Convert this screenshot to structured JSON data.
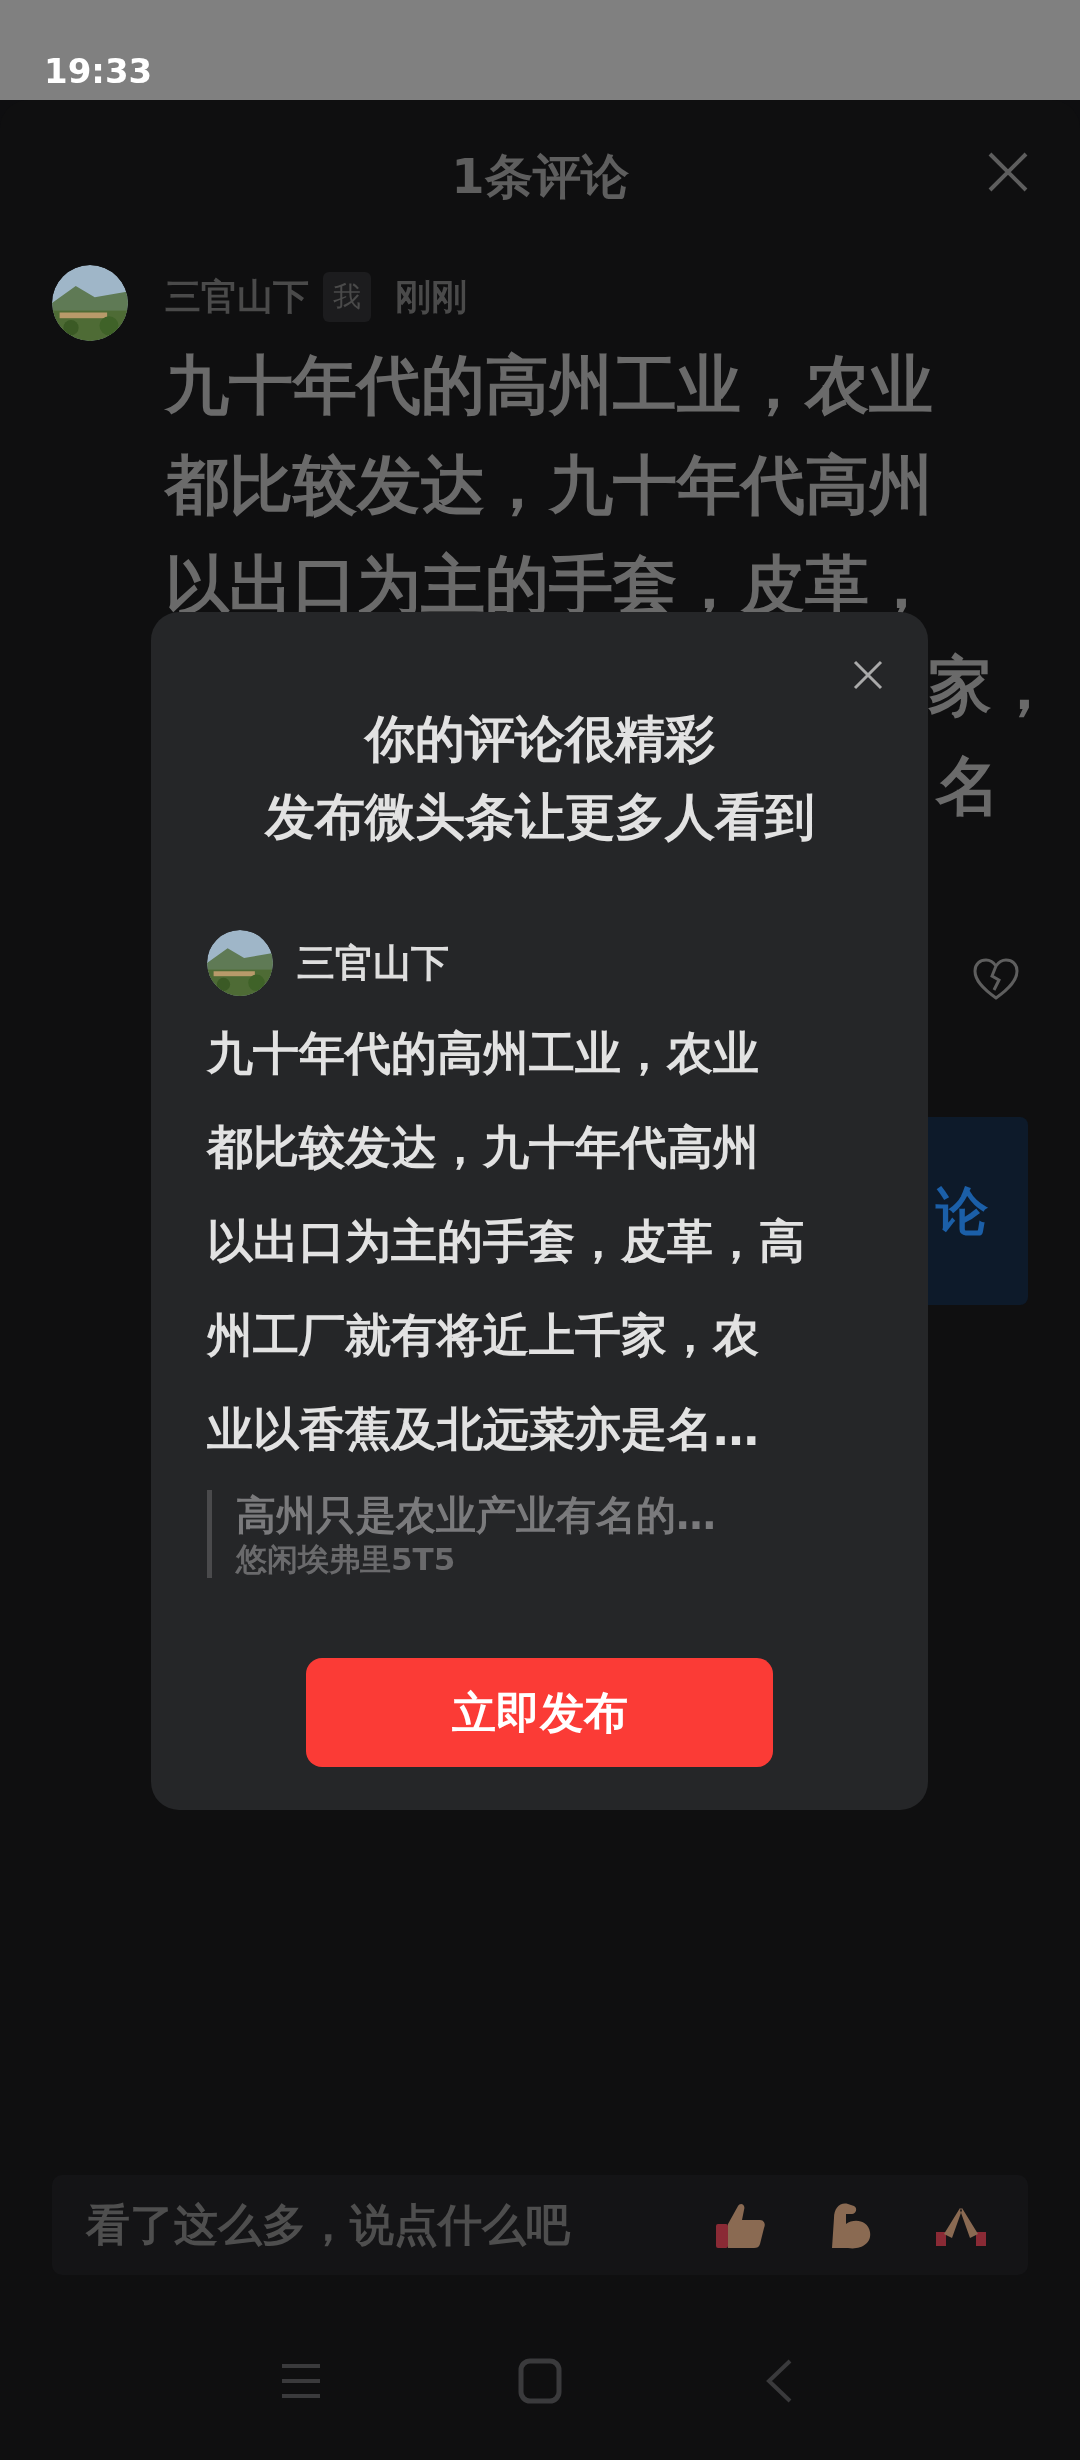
{
  "status_bar": {
    "time": "19:33"
  },
  "sheet": {
    "title": "1条评论"
  },
  "comment": {
    "author": "三官山下",
    "badge": "我",
    "time": "刚刚",
    "lines": [
      "九十年代的高州工业，农业",
      "都比较发达，九十年代高州",
      "以出口为主的手套，皮革，"
    ],
    "partial_lines": [
      "家，",
      "名"
    ],
    "button_fragment": "论"
  },
  "dialog": {
    "title_lines": [
      "你的评论很精彩",
      "发布微头条让更多人看到"
    ],
    "author": "三官山下",
    "body_lines": [
      "九十年代的高州工业，农业",
      "都比较发达，九十年代高州",
      "以出口为主的手套，皮革，高",
      "州工厂就有将近上千家，农",
      "业以香蕉及北远菜亦是名…"
    ],
    "quote": {
      "text": "高州只是农业产业有名的…",
      "author": "悠闲埃弗里5T5"
    },
    "button": "立即发布"
  },
  "input": {
    "placeholder": "看了这么多，说点什么吧"
  }
}
